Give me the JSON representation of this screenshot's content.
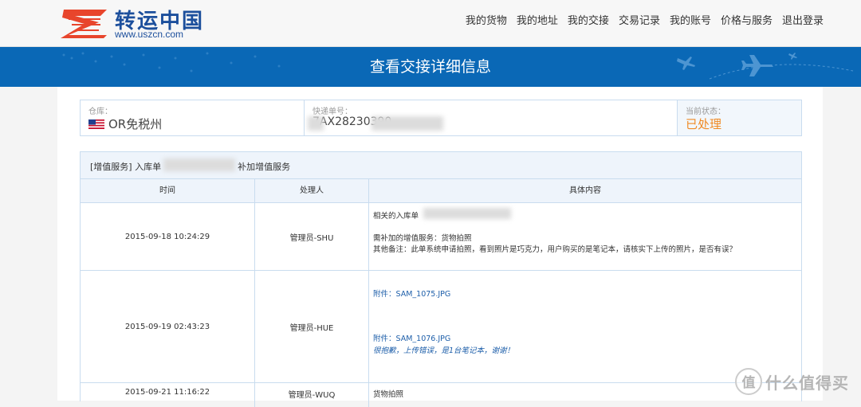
{
  "brand": {
    "name": "转运中国",
    "url": "www.uszcn.com",
    "colors": {
      "primary": "#1c4f9c",
      "accent": "#e8452c",
      "banner": "#0a68b6"
    }
  },
  "nav": [
    {
      "label": "我的货物"
    },
    {
      "label": "我的地址"
    },
    {
      "label": "我的交接"
    },
    {
      "label": "交易记录"
    },
    {
      "label": "我的账号"
    },
    {
      "label": "价格与服务"
    },
    {
      "label": "退出登录"
    }
  ],
  "banner": {
    "title": "查看交接详细信息",
    "decor_icon": "airplane-icon"
  },
  "info": {
    "warehouse_label": "仓库：",
    "warehouse_value": "OR免税州",
    "warehouse_flag": "us-flag-icon",
    "tracking_label": "快递单号：",
    "tracking_value": "7AX28230390",
    "status_label": "当前状态：",
    "status_value": "已处理",
    "status_color": "#f08a24"
  },
  "ticket": {
    "header_prefix": "[增值服务] 入库单",
    "header_suffix": "补加增值服务",
    "columns": [
      "时间",
      "处理人",
      "具体内容"
    ],
    "rows": [
      {
        "time": "2015-09-18 10:24:29",
        "handler": "管理员-SHU",
        "lines": [
          {
            "text": "相关的入库单",
            "style": "plain"
          },
          {
            "text": "",
            "style": "plain"
          },
          {
            "text": "需补加的增值服务：货物拍照",
            "style": "plain"
          },
          {
            "text": "其他备注：此单系统申请拍照，看到照片是巧克力，用户购买的是笔记本，请核实下上传的照片，是否有误？",
            "style": "plain"
          }
        ]
      },
      {
        "time": "2015-09-19 02:43:23",
        "handler": "管理员-HUE",
        "lines": [
          {
            "text": "附件：SAM_1075.JPG",
            "style": "link"
          },
          {
            "text": "附件：SAM_1076.JPG",
            "style": "link"
          },
          {
            "text": "很抱歉，上传错误，是1台笔记本，谢谢！",
            "style": "note"
          }
        ]
      },
      {
        "time": "2015-09-21 11:16:22",
        "handler": "管理员-WUQ",
        "lines": [
          {
            "text": "货物拍照",
            "style": "plain"
          }
        ]
      }
    ]
  },
  "watermark": {
    "badge": "值",
    "text": "什么值得买"
  }
}
